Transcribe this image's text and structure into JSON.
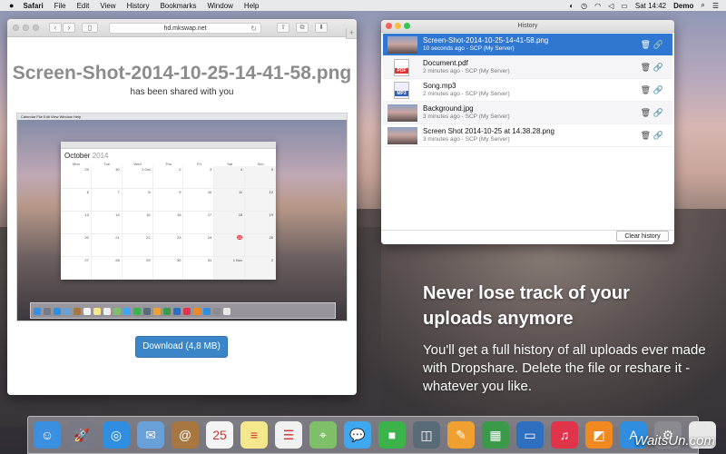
{
  "menubar": {
    "apple": "",
    "items": [
      "Safari",
      "File",
      "Edit",
      "View",
      "History",
      "Bookmarks",
      "Window",
      "Help"
    ],
    "clock": "Sat 14:42",
    "user": "Demo"
  },
  "safari": {
    "url": "hd.mkswap.net",
    "file_title": "Screen-Shot-2014-10-25-14-41-58.png",
    "shared_text": "has been shared with you",
    "download_label": "Download (4,8 MB)",
    "preview": {
      "menu": "Calendar   File   Edit   View   Window   Help",
      "month": "October",
      "year": "2014",
      "weekdays": [
        "Mon",
        "Tue",
        "Wed",
        "Thu",
        "Fri",
        "Sat",
        "Sun"
      ],
      "cells": [
        "29",
        "30",
        "1 Oct",
        "2",
        "3",
        "4",
        "5",
        "6",
        "7",
        "8",
        "9",
        "10",
        "11",
        "12",
        "13",
        "14",
        "15",
        "16",
        "17",
        "18",
        "19",
        "20",
        "21",
        "22",
        "23",
        "24",
        "25",
        "26",
        "27",
        "28",
        "29",
        "30",
        "31",
        "1 Nov",
        "2"
      ],
      "today": "25"
    }
  },
  "history": {
    "title": "History",
    "rows": [
      {
        "name": "Screen-Shot-2014-10-25-14-41-58.png",
        "meta": "10 seconds ago - SCP (My Server)",
        "kind": "img",
        "selected": true
      },
      {
        "name": "Document.pdf",
        "meta": "2 minutes ago - SCP (My Server)",
        "kind": "pdf",
        "badge": "PDF"
      },
      {
        "name": "Song.mp3",
        "meta": "2 minutes ago - SCP (My Server)",
        "kind": "mp3",
        "badge": "MP3"
      },
      {
        "name": "Background.jpg",
        "meta": "3 minutes ago - SCP (My Server)",
        "kind": "img"
      },
      {
        "name": "Screen Shot 2014-10-25 at 14.38.28.png",
        "meta": "3 minutes ago - SCP (My Server)",
        "kind": "img"
      }
    ],
    "clear_label": "Clear history"
  },
  "promo": {
    "headline": "Never lose track of your uploads anymore",
    "body": "You'll get a full history of all uploads ever made with Dropshare. Delete the file or reshare it - whatever you like."
  },
  "dock": {
    "apps": [
      {
        "name": "finder",
        "color": "#3b8fe0",
        "glyph": "☺"
      },
      {
        "name": "launchpad",
        "color": "#777a84",
        "glyph": "🚀"
      },
      {
        "name": "safari",
        "color": "#2f8ee0",
        "glyph": "◎"
      },
      {
        "name": "mail",
        "color": "#6aa0d8",
        "glyph": "✉"
      },
      {
        "name": "contacts",
        "color": "#a8763f",
        "glyph": "@"
      },
      {
        "name": "calendar",
        "color": "#f4f4f4",
        "glyph": "25"
      },
      {
        "name": "notes",
        "color": "#f5e88c",
        "glyph": "≡"
      },
      {
        "name": "reminders",
        "color": "#f0f0f0",
        "glyph": "☰"
      },
      {
        "name": "maps",
        "color": "#7fbf6a",
        "glyph": "⌖"
      },
      {
        "name": "messages",
        "color": "#3fa6f0",
        "glyph": "💬"
      },
      {
        "name": "facetime",
        "color": "#3bb34a",
        "glyph": "■"
      },
      {
        "name": "photo-booth",
        "color": "#5a6b78",
        "glyph": "◫"
      },
      {
        "name": "pages",
        "color": "#f0a030",
        "glyph": "✎"
      },
      {
        "name": "numbers",
        "color": "#3a9a4a",
        "glyph": "▦"
      },
      {
        "name": "keynote",
        "color": "#2f6fc0",
        "glyph": "▭"
      },
      {
        "name": "itunes",
        "color": "#e0344a",
        "glyph": "♫"
      },
      {
        "name": "ibooks",
        "color": "#f08a20",
        "glyph": "◩"
      },
      {
        "name": "app-store",
        "color": "#2f8ee0",
        "glyph": "A"
      },
      {
        "name": "system-preferences",
        "color": "#8a8a90",
        "glyph": "⚙"
      },
      {
        "name": "dropshare",
        "color": "#e8e8e8",
        "glyph": ""
      }
    ],
    "watermark": "WaitsUn.com"
  }
}
